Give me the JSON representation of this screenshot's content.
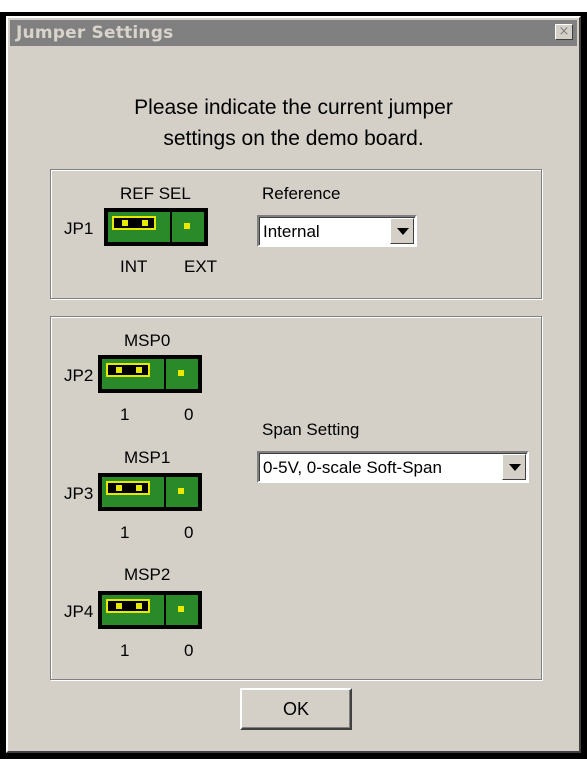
{
  "window": {
    "title": "Jumper Settings",
    "close_glyph": "×"
  },
  "prompt": {
    "line1": "Please indicate the current jumper",
    "line2": "settings on the demo board."
  },
  "reference_group": {
    "jumper_id": "JP1",
    "jumper_title": "REF SEL",
    "left_label": "INT",
    "right_label": "EXT",
    "combo_label": "Reference",
    "combo_value": "Internal"
  },
  "span_group": {
    "jumpers": [
      {
        "id": "JP2",
        "title": "MSP0",
        "left_label": "1",
        "right_label": "0"
      },
      {
        "id": "JP3",
        "title": "MSP1",
        "left_label": "1",
        "right_label": "0"
      },
      {
        "id": "JP4",
        "title": "MSP2",
        "left_label": "1",
        "right_label": "0"
      }
    ],
    "combo_label": "Span Setting",
    "combo_value": "0-5V, 0-scale Soft-Span"
  },
  "ok_label": "OK",
  "colors": {
    "dialog_bg": "#d4d0c8",
    "board_green": "#2a8a2a",
    "pin_yellow": "#e8e800",
    "titlebar": "#808080"
  },
  "icons": {
    "close": "close-icon",
    "dropdown": "chevron-down-icon"
  }
}
